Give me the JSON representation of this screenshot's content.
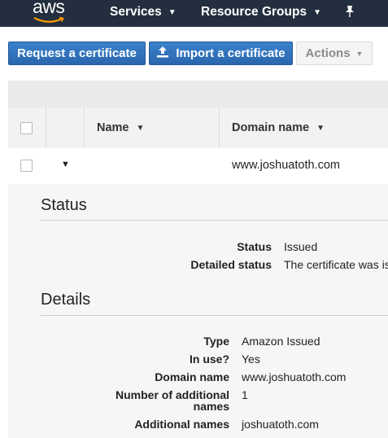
{
  "nav": {
    "logo": "aws",
    "services_label": "Services",
    "resource_groups_label": "Resource Groups",
    "caret_icon": "chevron-down-icon",
    "pin_icon": "pin-icon"
  },
  "toolbar": {
    "request_label": "Request a certificate",
    "import_label": "Import a certificate",
    "actions_label": "Actions"
  },
  "table": {
    "columns": [
      "Name",
      "Domain name"
    ],
    "rows": [
      {
        "name": "",
        "domain_name": "www.joshuatoth.com"
      }
    ]
  },
  "status": {
    "title": "Status",
    "fields": [
      {
        "label": "Status",
        "value": "Issued"
      },
      {
        "label": "Detailed status",
        "value": "The certificate was is"
      }
    ]
  },
  "details": {
    "title": "Details",
    "fields": [
      {
        "label": "Type",
        "value": "Amazon Issued"
      },
      {
        "label": "In use?",
        "value": "Yes"
      },
      {
        "label": "Domain name",
        "value": "www.joshuatoth.com"
      },
      {
        "label": "Number of additional names",
        "value": "1"
      },
      {
        "label": "Additional names",
        "value": "joshuatoth.com"
      }
    ]
  },
  "colors": {
    "nav_bg": "#232f3e",
    "primary_button": "#2f6fb8",
    "smile_orange": "#ff9900"
  }
}
